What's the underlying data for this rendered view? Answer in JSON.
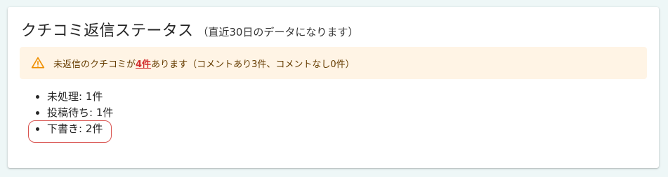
{
  "card": {
    "title": "クチコミ返信ステータス",
    "subtitle": "（直近30日のデータになります）"
  },
  "alert": {
    "icon": "warning-icon",
    "text_before": "未返信のクチコミが",
    "count_link": "4件",
    "text_after": "あります（コメントあり3件、コメントなし0件）",
    "colors": {
      "background": "#fff4e5",
      "text": "#663c00",
      "icon": "#ef8f00",
      "count": "#d32f2f"
    }
  },
  "status_list": {
    "items": [
      {
        "label": "未処理",
        "count": "1件"
      },
      {
        "label": "投稿待ち",
        "count": "1件"
      },
      {
        "label": "下書き",
        "count": "2件"
      }
    ]
  },
  "highlight": {
    "target": "下書き",
    "color": "#d9534f"
  }
}
